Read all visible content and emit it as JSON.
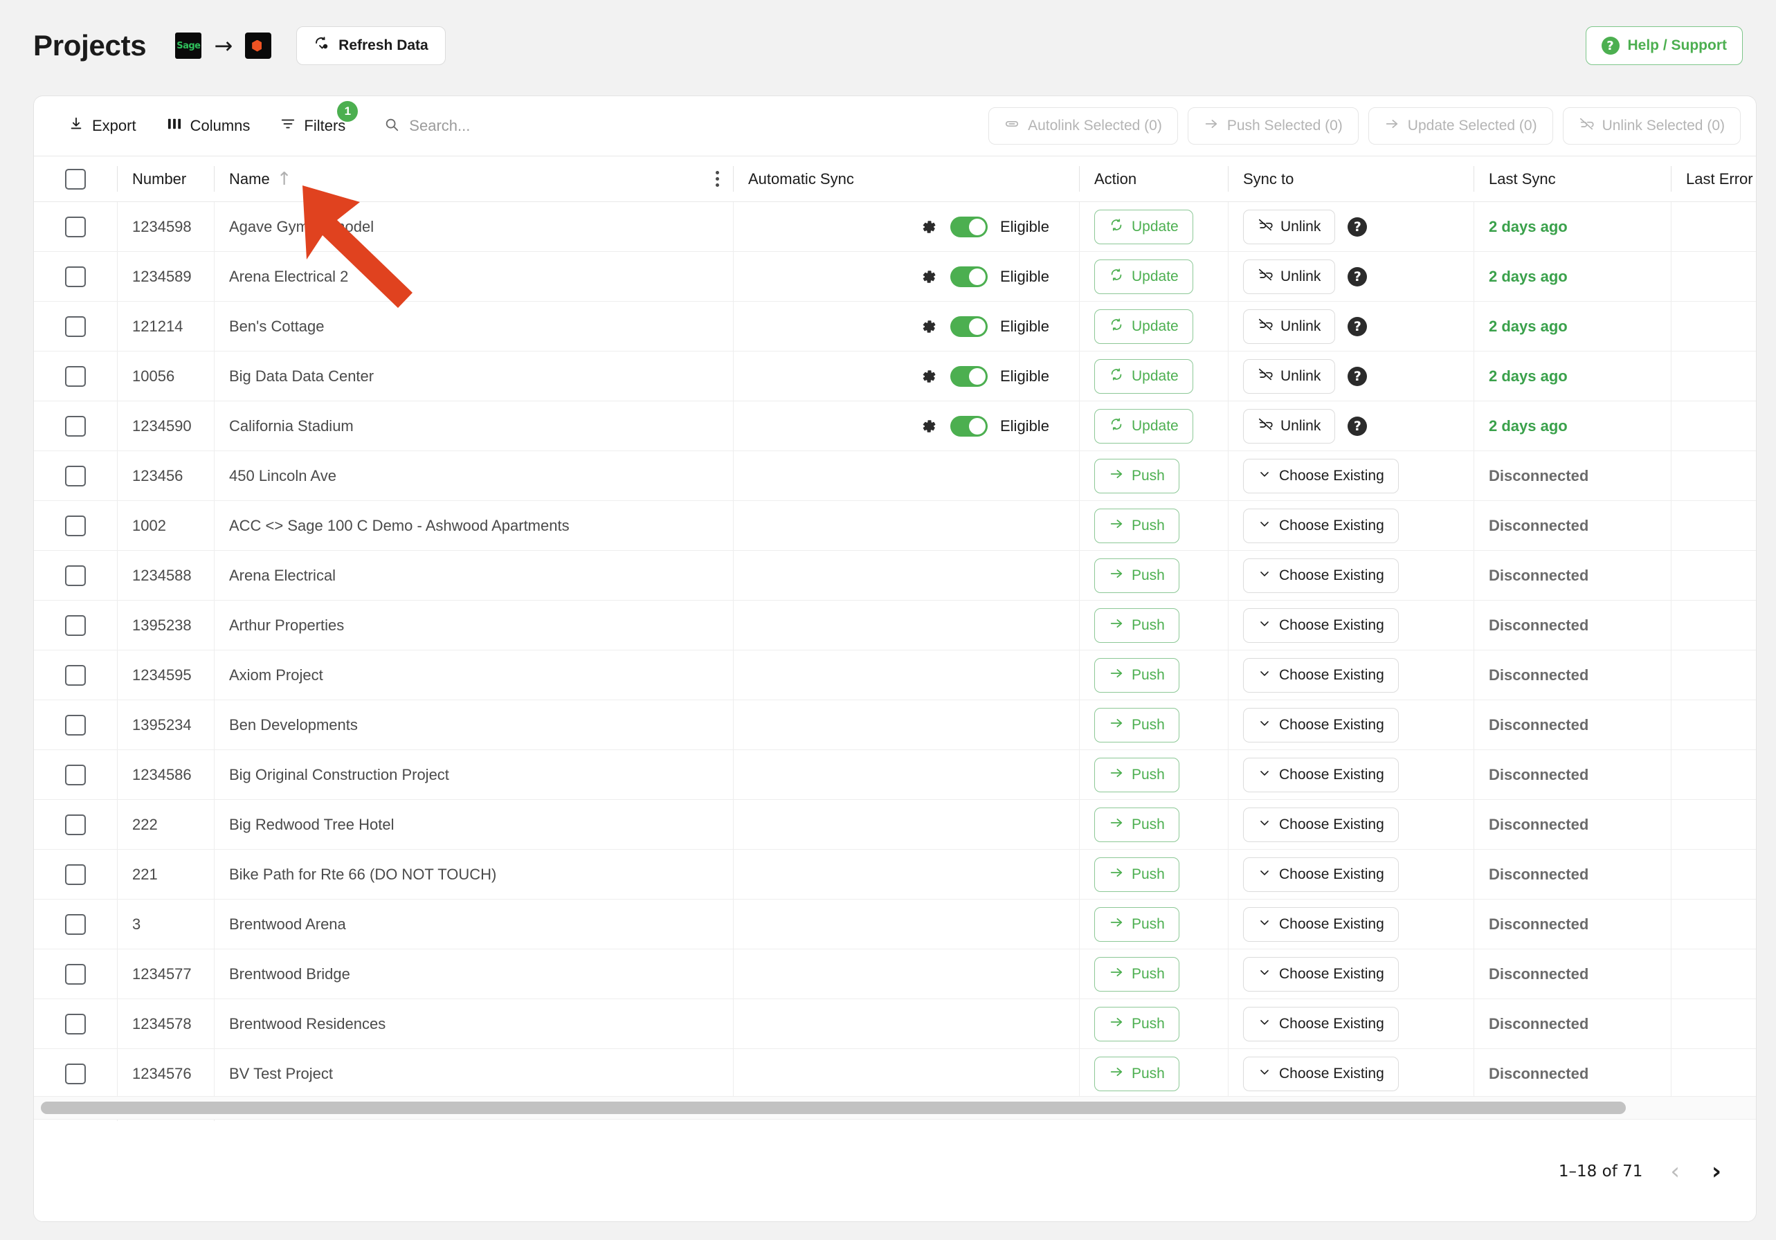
{
  "header": {
    "title": "Projects",
    "source_logo_label": "Sage",
    "arrow_glyph": "→",
    "refresh_label": "Refresh Data",
    "help_label": "Help / Support",
    "help_icon_glyph": "?"
  },
  "toolbar": {
    "export_label": "Export",
    "columns_label": "Columns",
    "filters_label": "Filters",
    "filters_badge": "1",
    "search_placeholder": "Search...",
    "search_value": "",
    "bulk_actions": [
      {
        "label": "Autolink Selected (0)",
        "icon": "link-icon",
        "disabled": true
      },
      {
        "label": "Push Selected (0)",
        "icon": "arrow-right-icon",
        "disabled": true
      },
      {
        "label": "Update Selected (0)",
        "icon": "arrow-right-icon",
        "disabled": true
      },
      {
        "label": "Unlink Selected (0)",
        "icon": "unlink-icon",
        "disabled": true
      }
    ]
  },
  "table": {
    "columns": {
      "number": "Number",
      "name": "Name",
      "automatic_sync": "Automatic Sync",
      "action": "Action",
      "sync_to": "Sync to",
      "last_sync": "Last Sync",
      "last_error": "Last Error"
    },
    "sort": {
      "column": "Name",
      "direction": "asc",
      "glyph": "↑"
    },
    "rows": [
      {
        "number": "1234598",
        "name": "Agave Gym Remodel",
        "linked": true,
        "auto_sync_label": "Eligible",
        "auto_sync_on": true,
        "action_label": "Update",
        "sync_to_label": "Unlink",
        "has_help": true,
        "last_sync": "2 days ago",
        "status_kind": "green"
      },
      {
        "number": "1234589",
        "name": "Arena Electrical 2",
        "linked": true,
        "auto_sync_label": "Eligible",
        "auto_sync_on": true,
        "action_label": "Update",
        "sync_to_label": "Unlink",
        "has_help": true,
        "last_sync": "2 days ago",
        "status_kind": "green"
      },
      {
        "number": "121214",
        "name": "Ben's Cottage",
        "linked": true,
        "auto_sync_label": "Eligible",
        "auto_sync_on": true,
        "action_label": "Update",
        "sync_to_label": "Unlink",
        "has_help": true,
        "last_sync": "2 days ago",
        "status_kind": "green"
      },
      {
        "number": "10056",
        "name": "Big Data Data Center",
        "linked": true,
        "auto_sync_label": "Eligible",
        "auto_sync_on": true,
        "action_label": "Update",
        "sync_to_label": "Unlink",
        "has_help": true,
        "last_sync": "2 days ago",
        "status_kind": "green"
      },
      {
        "number": "1234590",
        "name": "California Stadium",
        "linked": true,
        "auto_sync_label": "Eligible",
        "auto_sync_on": true,
        "action_label": "Update",
        "sync_to_label": "Unlink",
        "has_help": true,
        "last_sync": "2 days ago",
        "status_kind": "green"
      },
      {
        "number": "123456",
        "name": "450 Lincoln Ave",
        "linked": false,
        "auto_sync_label": "",
        "auto_sync_on": false,
        "action_label": "Push",
        "sync_to_label": "Choose Existing",
        "has_help": false,
        "last_sync": "Disconnected",
        "status_kind": "gray"
      },
      {
        "number": "1002",
        "name": "ACC <> Sage 100 C Demo - Ashwood Apartments",
        "linked": false,
        "auto_sync_label": "",
        "auto_sync_on": false,
        "action_label": "Push",
        "sync_to_label": "Choose Existing",
        "has_help": false,
        "last_sync": "Disconnected",
        "status_kind": "gray"
      },
      {
        "number": "1234588",
        "name": "Arena Electrical",
        "linked": false,
        "auto_sync_label": "",
        "auto_sync_on": false,
        "action_label": "Push",
        "sync_to_label": "Choose Existing",
        "has_help": false,
        "last_sync": "Disconnected",
        "status_kind": "gray"
      },
      {
        "number": "1395238",
        "name": "Arthur Properties",
        "linked": false,
        "auto_sync_label": "",
        "auto_sync_on": false,
        "action_label": "Push",
        "sync_to_label": "Choose Existing",
        "has_help": false,
        "last_sync": "Disconnected",
        "status_kind": "gray"
      },
      {
        "number": "1234595",
        "name": "Axiom Project",
        "linked": false,
        "auto_sync_label": "",
        "auto_sync_on": false,
        "action_label": "Push",
        "sync_to_label": "Choose Existing",
        "has_help": false,
        "last_sync": "Disconnected",
        "status_kind": "gray"
      },
      {
        "number": "1395234",
        "name": "Ben Developments",
        "linked": false,
        "auto_sync_label": "",
        "auto_sync_on": false,
        "action_label": "Push",
        "sync_to_label": "Choose Existing",
        "has_help": false,
        "last_sync": "Disconnected",
        "status_kind": "gray"
      },
      {
        "number": "1234586",
        "name": "Big Original Construction Project",
        "linked": false,
        "auto_sync_label": "",
        "auto_sync_on": false,
        "action_label": "Push",
        "sync_to_label": "Choose Existing",
        "has_help": false,
        "last_sync": "Disconnected",
        "status_kind": "gray"
      },
      {
        "number": "222",
        "name": "Big Redwood Tree Hotel",
        "linked": false,
        "auto_sync_label": "",
        "auto_sync_on": false,
        "action_label": "Push",
        "sync_to_label": "Choose Existing",
        "has_help": false,
        "last_sync": "Disconnected",
        "status_kind": "gray"
      },
      {
        "number": "221",
        "name": "Bike Path for Rte 66 (DO NOT TOUCH)",
        "linked": false,
        "auto_sync_label": "",
        "auto_sync_on": false,
        "action_label": "Push",
        "sync_to_label": "Choose Existing",
        "has_help": false,
        "last_sync": "Disconnected",
        "status_kind": "gray"
      },
      {
        "number": "3",
        "name": "Brentwood Arena",
        "linked": false,
        "auto_sync_label": "",
        "auto_sync_on": false,
        "action_label": "Push",
        "sync_to_label": "Choose Existing",
        "has_help": false,
        "last_sync": "Disconnected",
        "status_kind": "gray"
      },
      {
        "number": "1234577",
        "name": "Brentwood Bridge",
        "linked": false,
        "auto_sync_label": "",
        "auto_sync_on": false,
        "action_label": "Push",
        "sync_to_label": "Choose Existing",
        "has_help": false,
        "last_sync": "Disconnected",
        "status_kind": "gray"
      },
      {
        "number": "1234578",
        "name": "Brentwood Residences",
        "linked": false,
        "auto_sync_label": "",
        "auto_sync_on": false,
        "action_label": "Push",
        "sync_to_label": "Choose Existing",
        "has_help": false,
        "last_sync": "Disconnected",
        "status_kind": "gray"
      },
      {
        "number": "1234576",
        "name": "BV Test Project",
        "linked": false,
        "auto_sync_label": "",
        "auto_sync_on": false,
        "action_label": "Push",
        "sync_to_label": "Choose Existing",
        "has_help": false,
        "last_sync": "Disconnected",
        "status_kind": "gray"
      }
    ]
  },
  "footer": {
    "page_info": "1–18 of 71",
    "prev_glyph": "‹",
    "next_glyph": "›",
    "prev_disabled": true,
    "next_disabled": false
  },
  "annotation": {
    "type": "arrow",
    "color": "#e0421f",
    "points_at": "name-column-sort-arrow"
  },
  "colors": {
    "accent_green": "#4caf50",
    "status_green": "#3aa14b",
    "status_gray": "#6b6b6b",
    "annotation_red": "#e0421f",
    "page_background": "#f2f2f2"
  }
}
